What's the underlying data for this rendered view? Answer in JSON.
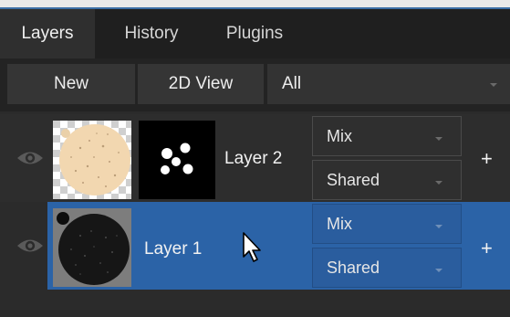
{
  "tabs": [
    {
      "label": "Layers",
      "active": true
    },
    {
      "label": "History",
      "active": false
    },
    {
      "label": "Plugins",
      "active": false
    }
  ],
  "toolbar": {
    "new_label": "New",
    "view_label": "2D View",
    "filter_value": "All"
  },
  "layers": [
    {
      "name": "Layer 2",
      "blend_mode": "Mix",
      "channel_mode": "Shared",
      "selected": false,
      "visibility_icon": "eye-icon",
      "add_label": "+"
    },
    {
      "name": "Layer 1",
      "blend_mode": "Mix",
      "channel_mode": "Shared",
      "selected": true,
      "visibility_icon": "eye-icon",
      "add_label": "+"
    }
  ],
  "colors": {
    "selection": "#2b63a7",
    "panel": "#2b2b2b",
    "tab_active": "#2f2f2f",
    "accent": "#3b6ea5"
  }
}
